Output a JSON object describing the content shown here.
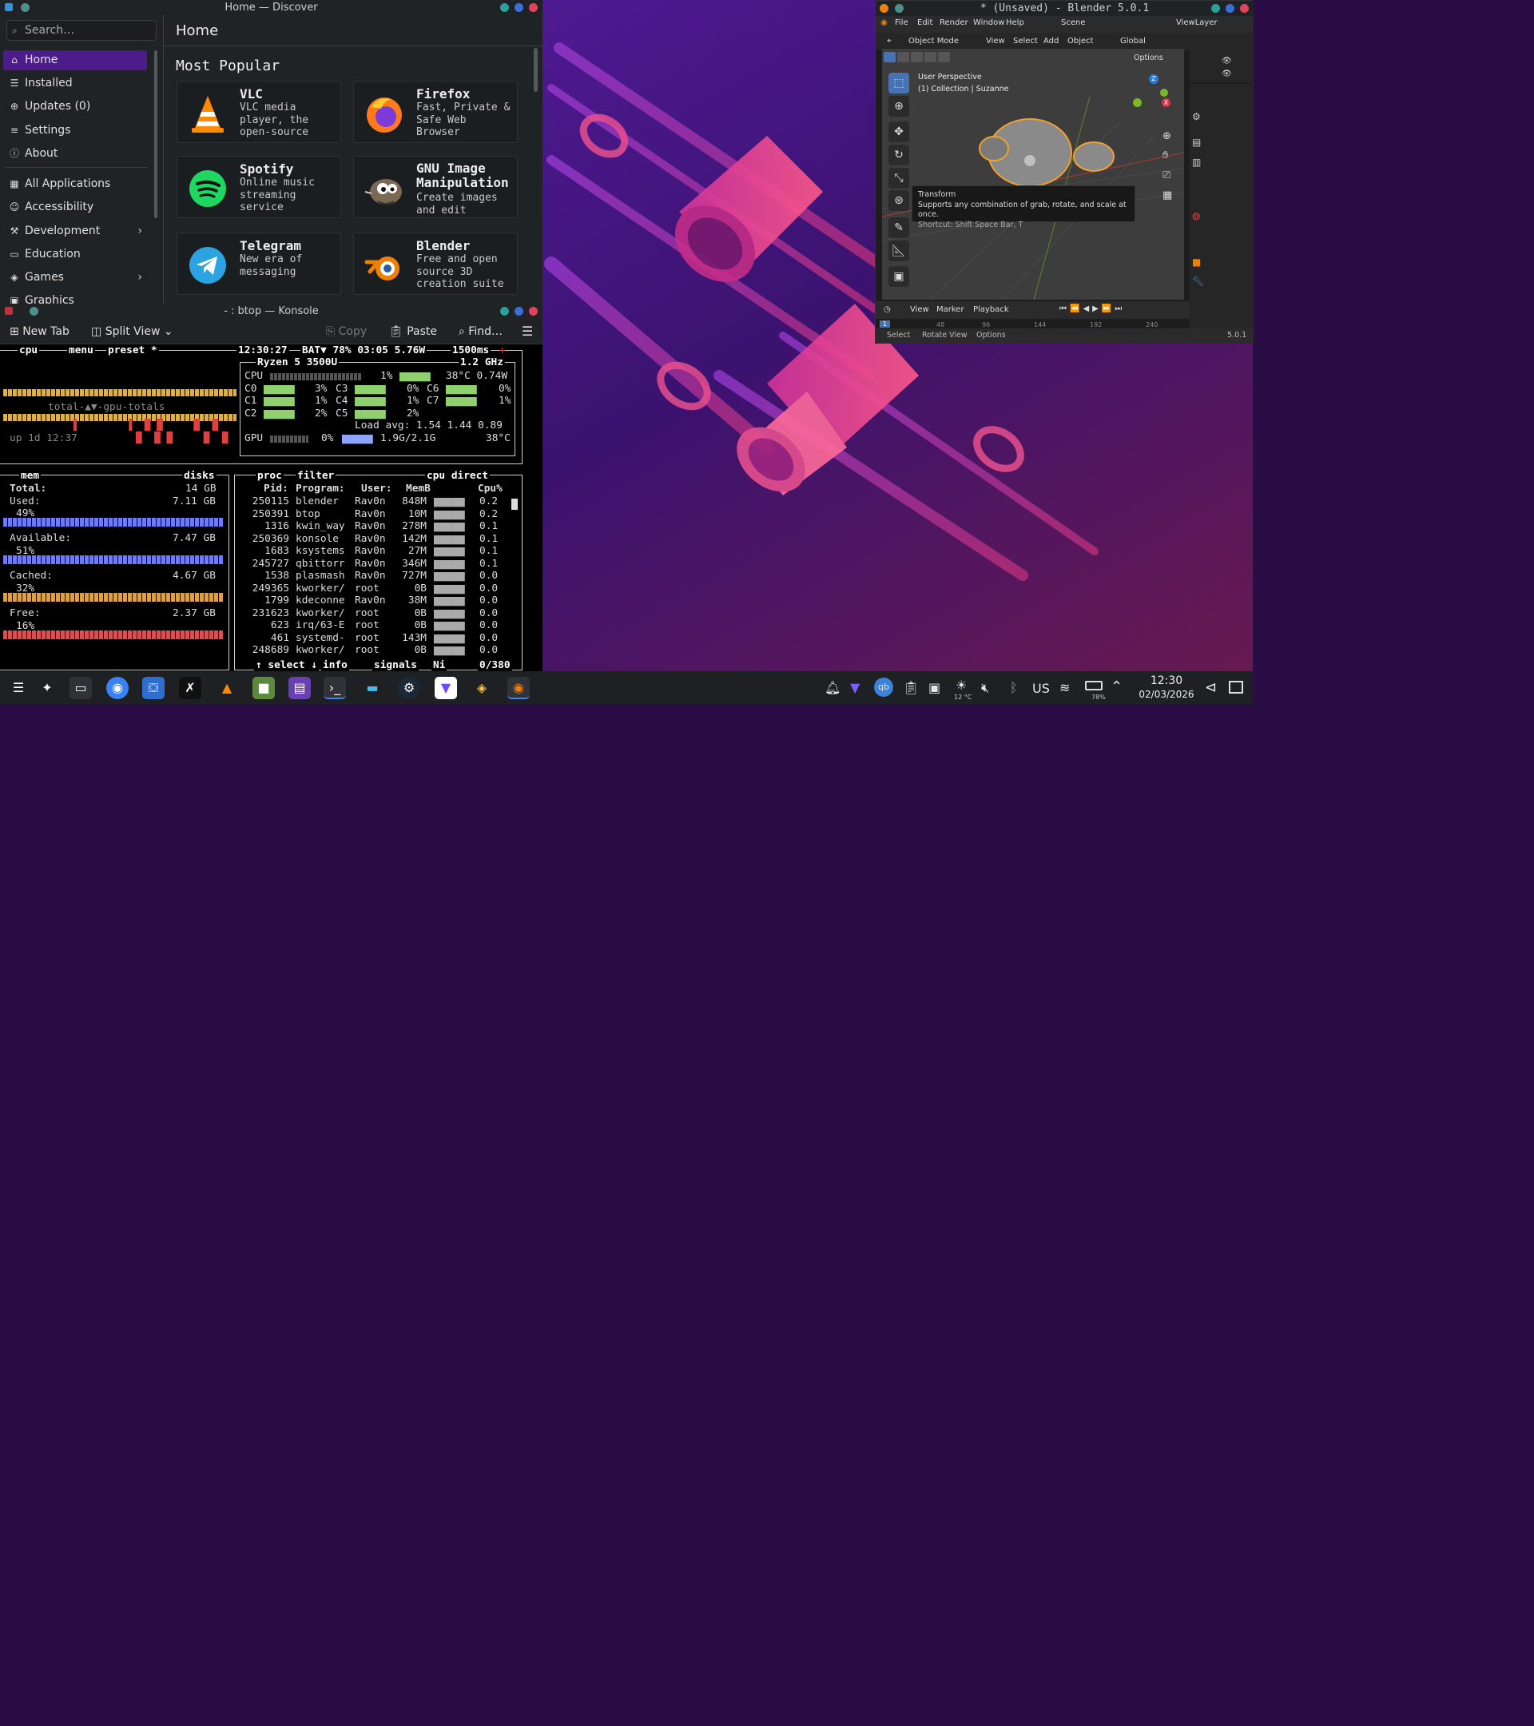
{
  "discover": {
    "title": "Home — Discover",
    "search_placeholder": "Search…",
    "page_title": "Home",
    "section_title": "Most Popular",
    "sidebar": [
      {
        "label": "Home",
        "icon": "home-icon"
      },
      {
        "label": "Installed",
        "icon": "list-icon"
      },
      {
        "label": "Updates (0)",
        "icon": "update-icon"
      },
      {
        "label": "Settings",
        "icon": "settings-icon"
      },
      {
        "label": "About",
        "icon": "info-icon"
      },
      {
        "label": "All Applications",
        "icon": "grid-icon"
      },
      {
        "label": "Accessibility",
        "icon": "accessibility-icon"
      },
      {
        "label": "Development",
        "icon": "wrench-icon"
      },
      {
        "label": "Education",
        "icon": "book-icon"
      },
      {
        "label": "Games",
        "icon": "gamepad-icon"
      },
      {
        "label": "Graphics",
        "icon": "image-icon"
      }
    ],
    "apps": [
      {
        "name": "VLC",
        "desc": "VLC media player, the open-source"
      },
      {
        "name": "Firefox",
        "desc": "Fast, Private & Safe Web Browser"
      },
      {
        "name": "Spotify",
        "desc": "Online music streaming service"
      },
      {
        "name": "GNU Image Manipulation",
        "desc": "Create images and edit"
      },
      {
        "name": "Telegram",
        "desc": "New era of messaging"
      },
      {
        "name": "Blender",
        "desc": "Free and open source 3D creation suite"
      }
    ]
  },
  "konsole": {
    "title": "- : btop — Konsole",
    "new_tab": "New Tab",
    "split_view": "Split View",
    "copy": "Copy",
    "paste": "Paste",
    "find": "Find…"
  },
  "btop": {
    "cpu_header": "cpu",
    "menu": "menu",
    "preset": "preset *",
    "clock": "12:30:27",
    "battery": "BAT▼ 78% 03:05 5.76W",
    "interval": "1500ms",
    "cpu_model": "Ryzen 5 3500U",
    "freq": "1.2 GHz",
    "cpu_row": "CPU",
    "cpu_pct": "1%",
    "cpu_temp": "38°C 0.74W",
    "cores": [
      [
        "C0",
        "3%"
      ],
      [
        "C3",
        "0%"
      ],
      [
        "C6",
        "0%"
      ],
      [
        "C1",
        "1%"
      ],
      [
        "C4",
        "1%"
      ],
      [
        "C7",
        "1%"
      ],
      [
        "C2",
        "2%"
      ],
      [
        "C5",
        "2%"
      ]
    ],
    "load_avg": "Load avg: 1.54 1.44 0.89",
    "gpu_row": "GPU",
    "gpu_pct": "0%",
    "gpu_mem": "1.9G/2.1G",
    "gpu_temp": "38°C",
    "totals_label": "total-▲▼-gpu-totals",
    "uptime": "up 1d 12:37",
    "mem_title": "mem",
    "disks_title": "disks",
    "mem_total_label": "Total:",
    "mem_total": "14 GB",
    "mem_rows": [
      {
        "label": "Used:",
        "value": "7.11 GB",
        "pct": "49%"
      },
      {
        "label": "Available:",
        "value": "7.47 GB",
        "pct": "51%"
      },
      {
        "label": "Cached:",
        "value": "4.67 GB",
        "pct": "32%"
      },
      {
        "label": "Free:",
        "value": "2.37 GB",
        "pct": "16%"
      }
    ],
    "proc_title": "proc",
    "filter": "filter",
    "sort": "cpu direct",
    "proc_headers": [
      "Pid:",
      "Program:",
      "User:",
      "MemB",
      "Cpu%"
    ],
    "procs": [
      [
        "250115",
        "blender",
        "Rav0n",
        "848M",
        "0.2"
      ],
      [
        "250391",
        "btop",
        "Rav0n",
        "10M",
        "0.2"
      ],
      [
        "1316",
        "kwin_way",
        "Rav0n",
        "278M",
        "0.1"
      ],
      [
        "250369",
        "konsole",
        "Rav0n",
        "142M",
        "0.1"
      ],
      [
        "1683",
        "ksystems",
        "Rav0n",
        "27M",
        "0.1"
      ],
      [
        "245727",
        "qbittorr",
        "Rav0n",
        "346M",
        "0.1"
      ],
      [
        "1538",
        "plasmash",
        "Rav0n",
        "727M",
        "0.0"
      ],
      [
        "249365",
        "kworker/",
        "root",
        "0B",
        "0.0"
      ],
      [
        "1799",
        "kdeconne",
        "Rav0n",
        "38M",
        "0.0"
      ],
      [
        "231623",
        "kworker/",
        "root",
        "0B",
        "0.0"
      ],
      [
        "623",
        "irq/63-E",
        "root",
        "0B",
        "0.0"
      ],
      [
        "461",
        "systemd-",
        "root",
        "143M",
        "0.0"
      ],
      [
        "248689",
        "kworker/",
        "root",
        "0B",
        "0.0"
      ]
    ],
    "footer": "↑ select ↓",
    "info": "info",
    "signals": "signals",
    "ni": "Ni",
    "count": "0/380"
  },
  "blender": {
    "title": "* (Unsaved) - Blender 5.0.1",
    "menus": [
      "File",
      "Edit",
      "Render",
      "Window",
      "Help"
    ],
    "scene": "Scene",
    "view_layer": "ViewLayer",
    "mode": "Object Mode",
    "header_menus": [
      "View",
      "Select",
      "Add",
      "Object"
    ],
    "orientation": "Global",
    "options": "Options",
    "viewport_label": "User Perspective",
    "collection": "(1) Collection | Suzanne",
    "tooltip_title": "Transform",
    "tooltip_desc": "Supports any combination of grab, rotate, and scale at once.",
    "tooltip_shortcut": "Shortcut: Shift Space Bar, T",
    "timeline_menus": [
      "View",
      "Marker",
      "Playback"
    ],
    "frames": [
      "1",
      "48",
      "96",
      "144",
      "192",
      "240"
    ],
    "status": [
      "Select",
      "Rotate View",
      "Options"
    ],
    "version": "5.0.1"
  },
  "taskbar": {
    "time": "12:30",
    "date": "02/03/2026",
    "keyboard": "US",
    "battery": "78%",
    "weather": "12 °C",
    "apps": [
      "menu-icon",
      "overview-icon",
      "terminal-icon",
      "chromium-icon",
      "discover-icon",
      "inkscape-icon",
      "vlc-icon",
      "minecraft-icon",
      "files-icon",
      "konsole-icon",
      "chat-icon",
      "steam-icon",
      "proton-icon",
      "layers-icon",
      "blender-icon"
    ]
  },
  "colors": {
    "accent": "#4c1d8a",
    "wallpaper_base": "#2a0d45",
    "pink": "#e84a86",
    "btop_used": "#d65252",
    "btop_cached": "#d9a24a",
    "btop_available": "#6e7bf2"
  }
}
